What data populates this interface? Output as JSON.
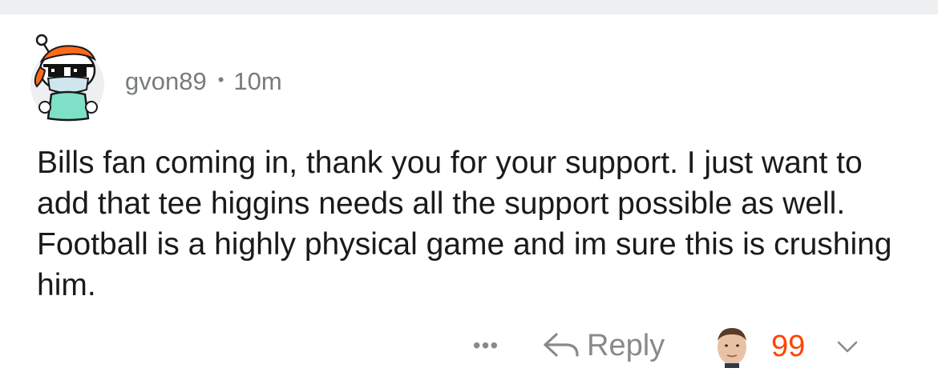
{
  "comment": {
    "author": "gvon89",
    "separator": "•",
    "time": "10m",
    "body": "Bills fan coming in, thank you for your support. I just want to add that tee higgins needs all the support possible as well. Football is a highly physical game and im sure this is crushing him."
  },
  "actions": {
    "more_label": "•••",
    "reply_label": "Reply",
    "score": "99"
  },
  "icons": {
    "avatar": "snoo-avatar-sunglasses-mask",
    "reply": "reply-arrow-icon",
    "award": "face-award-icon",
    "downvote": "chevron-down-icon"
  },
  "colors": {
    "score": "#ff4500",
    "meta_text": "#787c7e",
    "body_text": "#1a1a1b",
    "action_text": "#878a8c"
  }
}
